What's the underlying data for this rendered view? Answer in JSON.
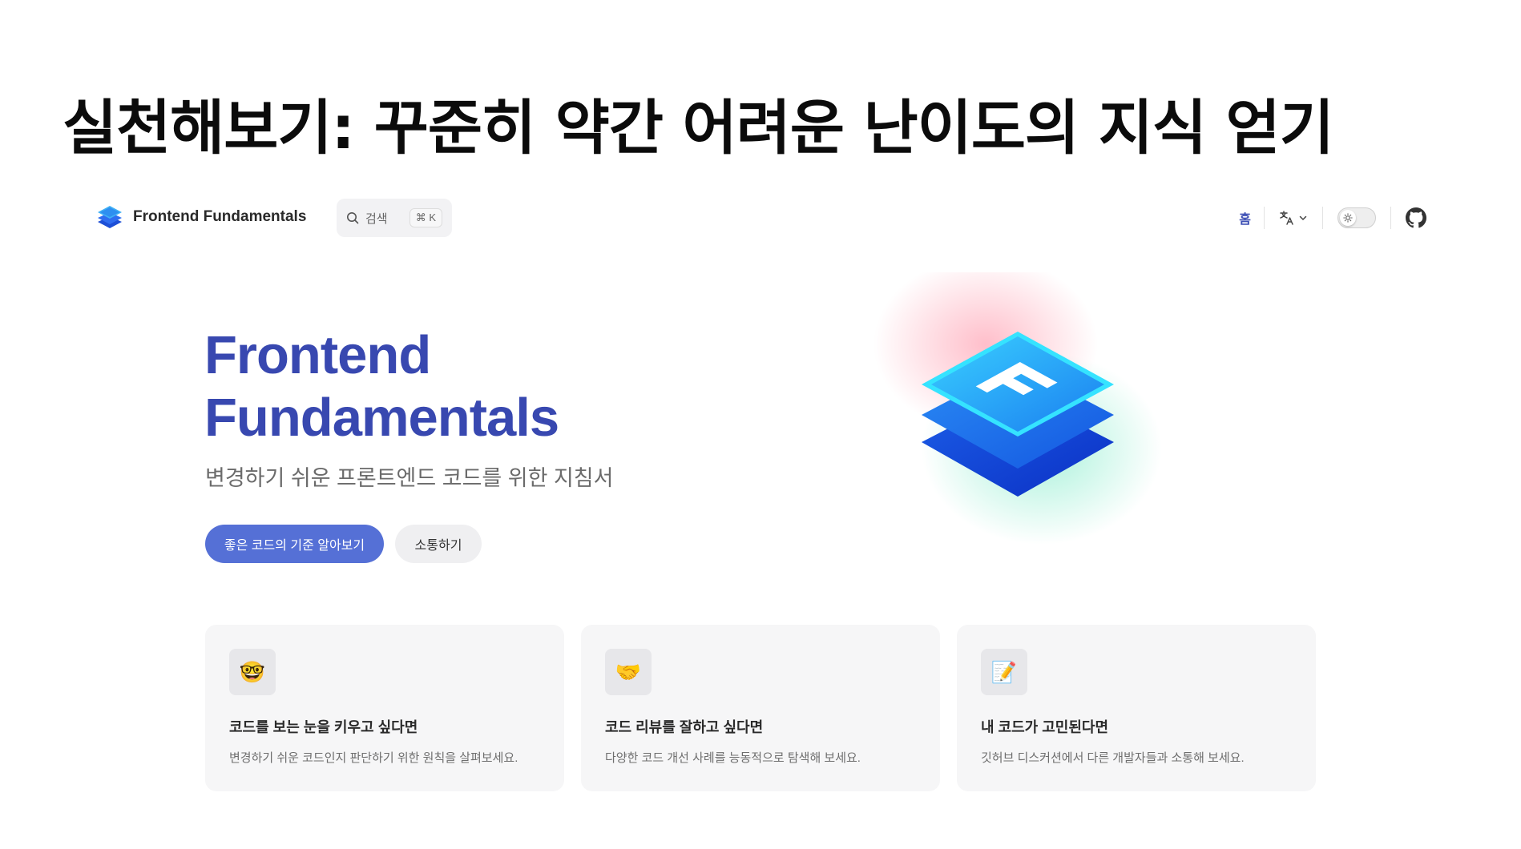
{
  "slide": {
    "title": "실천해보기: 꾸준히 약간 어려운 난이도의 지식 얻기"
  },
  "nav": {
    "brand": "Frontend Fundamentals",
    "search_label": "검색",
    "search_shortcut": "⌘ K",
    "home_link": "홈",
    "language_icon": "translate-icon",
    "theme_icon": "sun-icon",
    "github_icon": "github-icon"
  },
  "hero": {
    "title_line1": "Frontend",
    "title_line2": "Fundamentals",
    "subtitle": "변경하기 쉬운 프론트엔드 코드를 위한 지침서",
    "primary_button": "좋은 코드의 기준 알아보기",
    "secondary_button": "소통하기"
  },
  "cards": [
    {
      "icon": "🤓",
      "title": "코드를 보는 눈을 키우고 싶다면",
      "desc": "변경하기 쉬운 코드인지 판단하기 위한 원칙을 살펴보세요."
    },
    {
      "icon": "🤝",
      "title": "코드 리뷰를 잘하고 싶다면",
      "desc": "다양한 코드 개선 사례를 능동적으로 탐색해 보세요."
    },
    {
      "icon": "📝",
      "title": "내 코드가 고민된다면",
      "desc": "깃허브 디스커션에서 다른 개발자들과 소통해 보세요."
    }
  ],
  "colors": {
    "brand": "#3848b0",
    "primary_button": "#5570d6"
  }
}
